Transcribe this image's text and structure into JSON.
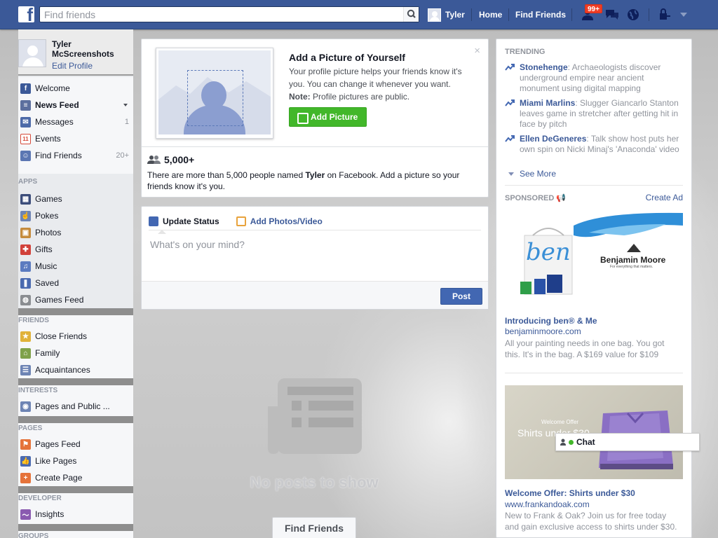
{
  "topbar": {
    "search_placeholder": "Find friends",
    "user_name": "Tyler",
    "home": "Home",
    "find_friends": "Find Friends",
    "notif_badge": "99+"
  },
  "profile": {
    "name": "Tyler McScreenshots",
    "edit": "Edit Profile"
  },
  "nav": {
    "main": [
      {
        "label": "Welcome",
        "count": "",
        "icon": "welcome-icon",
        "color": "#3b5998"
      },
      {
        "label": "News Feed",
        "count": "",
        "icon": "news-feed-icon",
        "color": "#5c6f9e"
      },
      {
        "label": "Messages",
        "count": "1",
        "icon": "messages-icon",
        "color": "#4d6aa8"
      },
      {
        "label": "Events",
        "count": "",
        "icon": "events-icon",
        "color": "#d54a3a"
      },
      {
        "label": "Find Friends",
        "count": "20+",
        "icon": "find-friends-icon",
        "color": "#5b76b2"
      }
    ],
    "apps_header": "APPS",
    "apps": [
      {
        "label": "Games",
        "icon": "games-icon",
        "color": "#3c4d7a"
      },
      {
        "label": "Pokes",
        "icon": "pokes-icon",
        "color": "#6d84b4"
      },
      {
        "label": "Photos",
        "icon": "photos-icon",
        "color": "#c58b3c"
      },
      {
        "label": "Gifts",
        "icon": "gifts-icon",
        "color": "#d1413a"
      },
      {
        "label": "Music",
        "icon": "music-icon",
        "color": "#5b7bc0"
      },
      {
        "label": "Saved",
        "icon": "saved-icon",
        "color": "#4a6ab0"
      },
      {
        "label": "Games Feed",
        "icon": "games-feed-icon",
        "color": "#8a8d91"
      }
    ],
    "friends_header": "FRIENDS",
    "friends": [
      {
        "label": "Close Friends",
        "icon": "close-friends-icon",
        "color": "#e0b23a"
      },
      {
        "label": "Family",
        "icon": "family-icon",
        "color": "#7fa14a"
      },
      {
        "label": "Acquaintances",
        "icon": "acquaintances-icon",
        "color": "#6d84b4"
      }
    ],
    "interests_header": "INTERESTS",
    "interests": [
      {
        "label": "Pages and Public ...",
        "icon": "pages-public-icon",
        "color": "#6d84b4"
      }
    ],
    "pages_header": "PAGES",
    "pages": [
      {
        "label": "Pages Feed",
        "icon": "pages-feed-icon",
        "color": "#e5733a"
      },
      {
        "label": "Like Pages",
        "icon": "like-pages-icon",
        "color": "#4a6ab0"
      },
      {
        "label": "Create Page",
        "icon": "create-page-icon",
        "color": "#e5733a"
      }
    ],
    "developer_header": "DEVELOPER",
    "developer": [
      {
        "label": "Insights",
        "icon": "insights-icon",
        "color": "#8a5ab0"
      }
    ],
    "groups_header": "GROUPS"
  },
  "add_picture": {
    "title": "Add a Picture of Yourself",
    "desc": "Your profile picture helps your friends know it's you. You can change it whenever you want.",
    "note_label": "Note:",
    "note_text": " Profile pictures are public.",
    "button": "Add Picture",
    "close": "×",
    "count": "5,000+",
    "info_pre": "There are more than 5,000 people named ",
    "info_name": "Tyler",
    "info_post": " on Facebook. Add a picture so your friends know it's you."
  },
  "composer": {
    "tab_status": "Update Status",
    "tab_photos": "Add Photos/Video",
    "placeholder": "What's on your mind?",
    "post": "Post"
  },
  "feed": {
    "empty": "No posts to show",
    "find_friends": "Find Friends"
  },
  "trending": {
    "header": "TRENDING",
    "items": [
      {
        "name": "Stonehenge",
        "text": ": Archaeologists discover underground empire near ancient monument using digital mapping"
      },
      {
        "name": "Miami Marlins",
        "text": ": Slugger Giancarlo Stanton leaves game in stretcher after getting hit in face by pitch"
      },
      {
        "name": "Ellen DeGeneres",
        "text": ": Talk show host puts her own spin on Nicki Minaj's 'Anaconda' video"
      }
    ],
    "see_more": "See More"
  },
  "sponsored": {
    "header": "SPONSORED",
    "create_ad": "Create Ad",
    "ads": [
      {
        "title": "Introducing ben® & Me",
        "url": "benjaminmoore.com",
        "desc": "All your painting needs in one bag. You got this. It's in the bag. A $169 value for $109",
        "img_brand": "Benjamin Moore",
        "img_tagline": "For everything that matters.",
        "img_script": "ben"
      },
      {
        "title": "Welcome Offer: Shirts under $30",
        "url": "www.frankandoak.com",
        "desc": "New to Frank & Oak? Join us for free today and gain exclusive access to shirts under $30.",
        "img_small": "Welcome Offer",
        "img_big": "Shirts under $30"
      }
    ]
  },
  "chat": {
    "label": "Chat"
  }
}
